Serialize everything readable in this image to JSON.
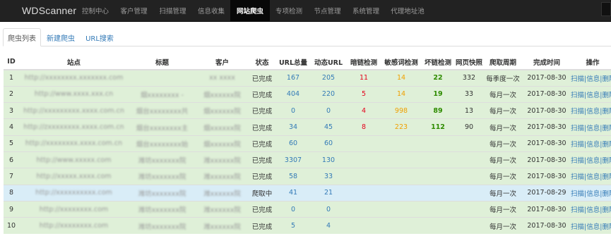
{
  "brand": "WDScanner",
  "nav": [
    {
      "label": "控制中心",
      "active": false
    },
    {
      "label": "客户管理",
      "active": false
    },
    {
      "label": "扫描管理",
      "active": false
    },
    {
      "label": "信息收集",
      "active": false
    },
    {
      "label": "网站爬虫",
      "active": true
    },
    {
      "label": "专项检测",
      "active": false
    },
    {
      "label": "节点管理",
      "active": false
    },
    {
      "label": "系统管理",
      "active": false
    },
    {
      "label": "代理地址池",
      "active": false
    }
  ],
  "tabs": [
    {
      "label": "爬虫列表",
      "active": true
    },
    {
      "label": "新建爬虫",
      "active": false
    },
    {
      "label": "URL搜索",
      "active": false
    }
  ],
  "table": {
    "headers": [
      "ID",
      "站点",
      "标题",
      "客户",
      "状态",
      "URL总量",
      "动态URL",
      "暗链检测",
      "敏感词检测",
      "坏链检测",
      "网页快照",
      "爬取周期",
      "完成时间",
      "操作"
    ],
    "rows": [
      {
        "id": "1",
        "site": "http://xxxxxxxx.xxxxxxx.com",
        "title": "",
        "customer": "xx xxxx",
        "status": "已完成",
        "url_total": "167",
        "dynamic_url": "205",
        "darklink": "11",
        "sensitive": "14",
        "badlink": "22",
        "snapshot": "332",
        "cycle": "每季度一次",
        "finish": "2017-08-30",
        "style": "success"
      },
      {
        "id": "2",
        "site": "http://www.xxxx.xxx.cn",
        "title": "烟xxxxxxxx -",
        "customer": "烟xxxxxx院",
        "status": "已完成",
        "url_total": "404",
        "dynamic_url": "220",
        "darklink": "5",
        "sensitive": "14",
        "badlink": "19",
        "snapshot": "33",
        "cycle": "每月一次",
        "finish": "2017-08-30",
        "style": "success"
      },
      {
        "id": "3",
        "site": "http://xxxxxxxxx.xxxx.com.cn",
        "title": "烟台xxxxxxxx共",
        "customer": "烟xxxxxx院",
        "status": "已完成",
        "url_total": "0",
        "dynamic_url": "0",
        "darklink": "4",
        "sensitive": "998",
        "badlink": "89",
        "snapshot": "13",
        "cycle": "每月一次",
        "finish": "2017-08-30",
        "style": "success"
      },
      {
        "id": "4",
        "site": "http://zxxxxxxxx.xxxx.com.cn",
        "title": "烟台xxxxxxxx主",
        "customer": "烟xxxxxx院",
        "status": "已完成",
        "url_total": "34",
        "dynamic_url": "45",
        "darklink": "8",
        "sensitive": "223",
        "badlink": "112",
        "snapshot": "90",
        "cycle": "每月一次",
        "finish": "2017-08-30",
        "style": "success"
      },
      {
        "id": "5",
        "site": "http://xxxxxxxx.xxxx.com.cn",
        "title": "烟台xxxxxxxx始",
        "customer": "烟xxxxxx院",
        "status": "已完成",
        "url_total": "60",
        "dynamic_url": "60",
        "darklink": "",
        "sensitive": "",
        "badlink": "",
        "snapshot": "",
        "cycle": "每月一次",
        "finish": "2017-08-30",
        "style": "success"
      },
      {
        "id": "6",
        "site": "http://www.xxxxx.com",
        "title": "潍坊xxxxxxx院",
        "customer": "潍xxxxxx院",
        "status": "已完成",
        "url_total": "3307",
        "dynamic_url": "130",
        "darklink": "",
        "sensitive": "",
        "badlink": "",
        "snapshot": "",
        "cycle": "每月一次",
        "finish": "2017-08-30",
        "style": "success"
      },
      {
        "id": "7",
        "site": "http://xxxxx.xxxx.com",
        "title": "潍坊xxxxxxx院",
        "customer": "潍xxxxxx院",
        "status": "已完成",
        "url_total": "58",
        "dynamic_url": "33",
        "darklink": "",
        "sensitive": "",
        "badlink": "",
        "snapshot": "",
        "cycle": "每月一次",
        "finish": "2017-08-30",
        "style": "success"
      },
      {
        "id": "8",
        "site": "http://xxxxxxxxxx.com",
        "title": "潍坊xxxxxxx院",
        "customer": "潍xxxxxx院",
        "status": "爬取中",
        "url_total": "41",
        "dynamic_url": "21",
        "darklink": "",
        "sensitive": "",
        "badlink": "",
        "snapshot": "",
        "cycle": "每月一次",
        "finish": "2017-08-29",
        "style": "info"
      },
      {
        "id": "9",
        "site": "http://xxxxxxxx.com",
        "title": "潍坊xxxxxxx院",
        "customer": "潍xxxxxx院",
        "status": "已完成",
        "url_total": "0",
        "dynamic_url": "0",
        "darklink": "",
        "sensitive": "",
        "badlink": "",
        "snapshot": "",
        "cycle": "每月一次",
        "finish": "2017-08-30",
        "style": "success"
      },
      {
        "id": "10",
        "site": "http://xxxxxxxx.com",
        "title": "潍坊xxxxxxx院",
        "customer": "潍xxxxxx院",
        "status": "已完成",
        "url_total": "5",
        "dynamic_url": "4",
        "darklink": "",
        "sensitive": "",
        "badlink": "",
        "snapshot": "",
        "cycle": "每月一次",
        "finish": "2017-08-30",
        "style": "success"
      }
    ],
    "ops": {
      "scan": "扫描",
      "info": "信息",
      "delete": "删除",
      "sep": "|"
    }
  },
  "colors": {
    "navbar": "#222222",
    "success_row": "#dff0d8",
    "info_row": "#d9edf7",
    "link": "#337ab7",
    "red": "#e4001b",
    "orange": "#f0a000",
    "green": "#2e8b00"
  }
}
